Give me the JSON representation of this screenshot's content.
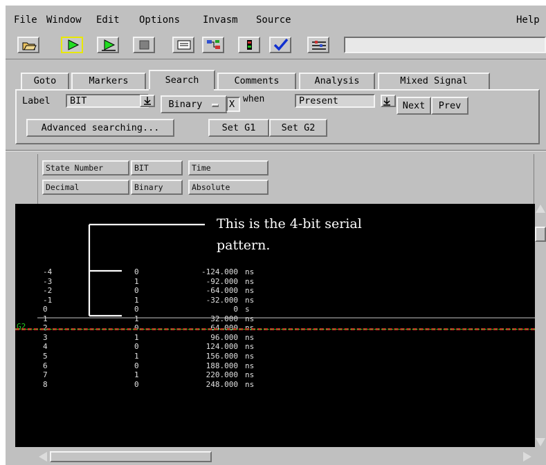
{
  "menubar": {
    "items": [
      "File",
      "Window",
      "Edit",
      "Options",
      "Invasm",
      "Source"
    ],
    "help": "Help"
  },
  "toolbar": {
    "icons": [
      "open-folder-icon",
      "run-icon",
      "run-repetitive-icon",
      "stop-icon",
      "list-window-icon",
      "connections-icon",
      "config-icon",
      "check-icon",
      "settings-icon"
    ],
    "status_text": ""
  },
  "tabs": [
    "Goto",
    "Markers",
    "Search",
    "Comments",
    "Analysis",
    "Mixed Signal"
  ],
  "active_tab": "Search",
  "search": {
    "label_text": "Label",
    "label_value": "BIT",
    "base_value": "Binary",
    "pattern_value": "X",
    "when_text": "when",
    "when_value": "Present",
    "next_label": "Next",
    "prev_label": "Prev",
    "advanced_label": "Advanced searching...",
    "set_g1_label": "Set G1",
    "set_g2_label": "Set G2"
  },
  "columns": [
    {
      "name": "State Number",
      "format": "Decimal"
    },
    {
      "name": "BIT",
      "format": "Binary"
    },
    {
      "name": "Time",
      "format": "Absolute"
    }
  ],
  "annotation": {
    "line1": "This is the 4-bit serial",
    "line2": "pattern."
  },
  "marker": {
    "label": "G2",
    "color": "#22cc22",
    "line_color": "#cc2222"
  },
  "rows": [
    {
      "state": "-4",
      "bit": "0",
      "time": "-124.000 ns"
    },
    {
      "state": "-3",
      "bit": "1",
      "time": "-92.000 ns"
    },
    {
      "state": "-2",
      "bit": "0",
      "time": "-64.000 ns"
    },
    {
      "state": "-1",
      "bit": "1",
      "time": "-32.000 ns"
    },
    {
      "state": "0",
      "bit": "0",
      "time": "0 s"
    },
    {
      "state": "1",
      "bit": "1",
      "time": "32.000 ns"
    },
    {
      "state": "2",
      "bit": "0",
      "time": "64.000 ns"
    },
    {
      "state": "3",
      "bit": "1",
      "time": "96.000 ns"
    },
    {
      "state": "4",
      "bit": "0",
      "time": "124.000 ns"
    },
    {
      "state": "5",
      "bit": "1",
      "time": "156.000 ns"
    },
    {
      "state": "6",
      "bit": "0",
      "time": "188.000 ns"
    },
    {
      "state": "7",
      "bit": "1",
      "time": "220.000 ns"
    },
    {
      "state": "8",
      "bit": "0",
      "time": "248.000 ns"
    }
  ]
}
